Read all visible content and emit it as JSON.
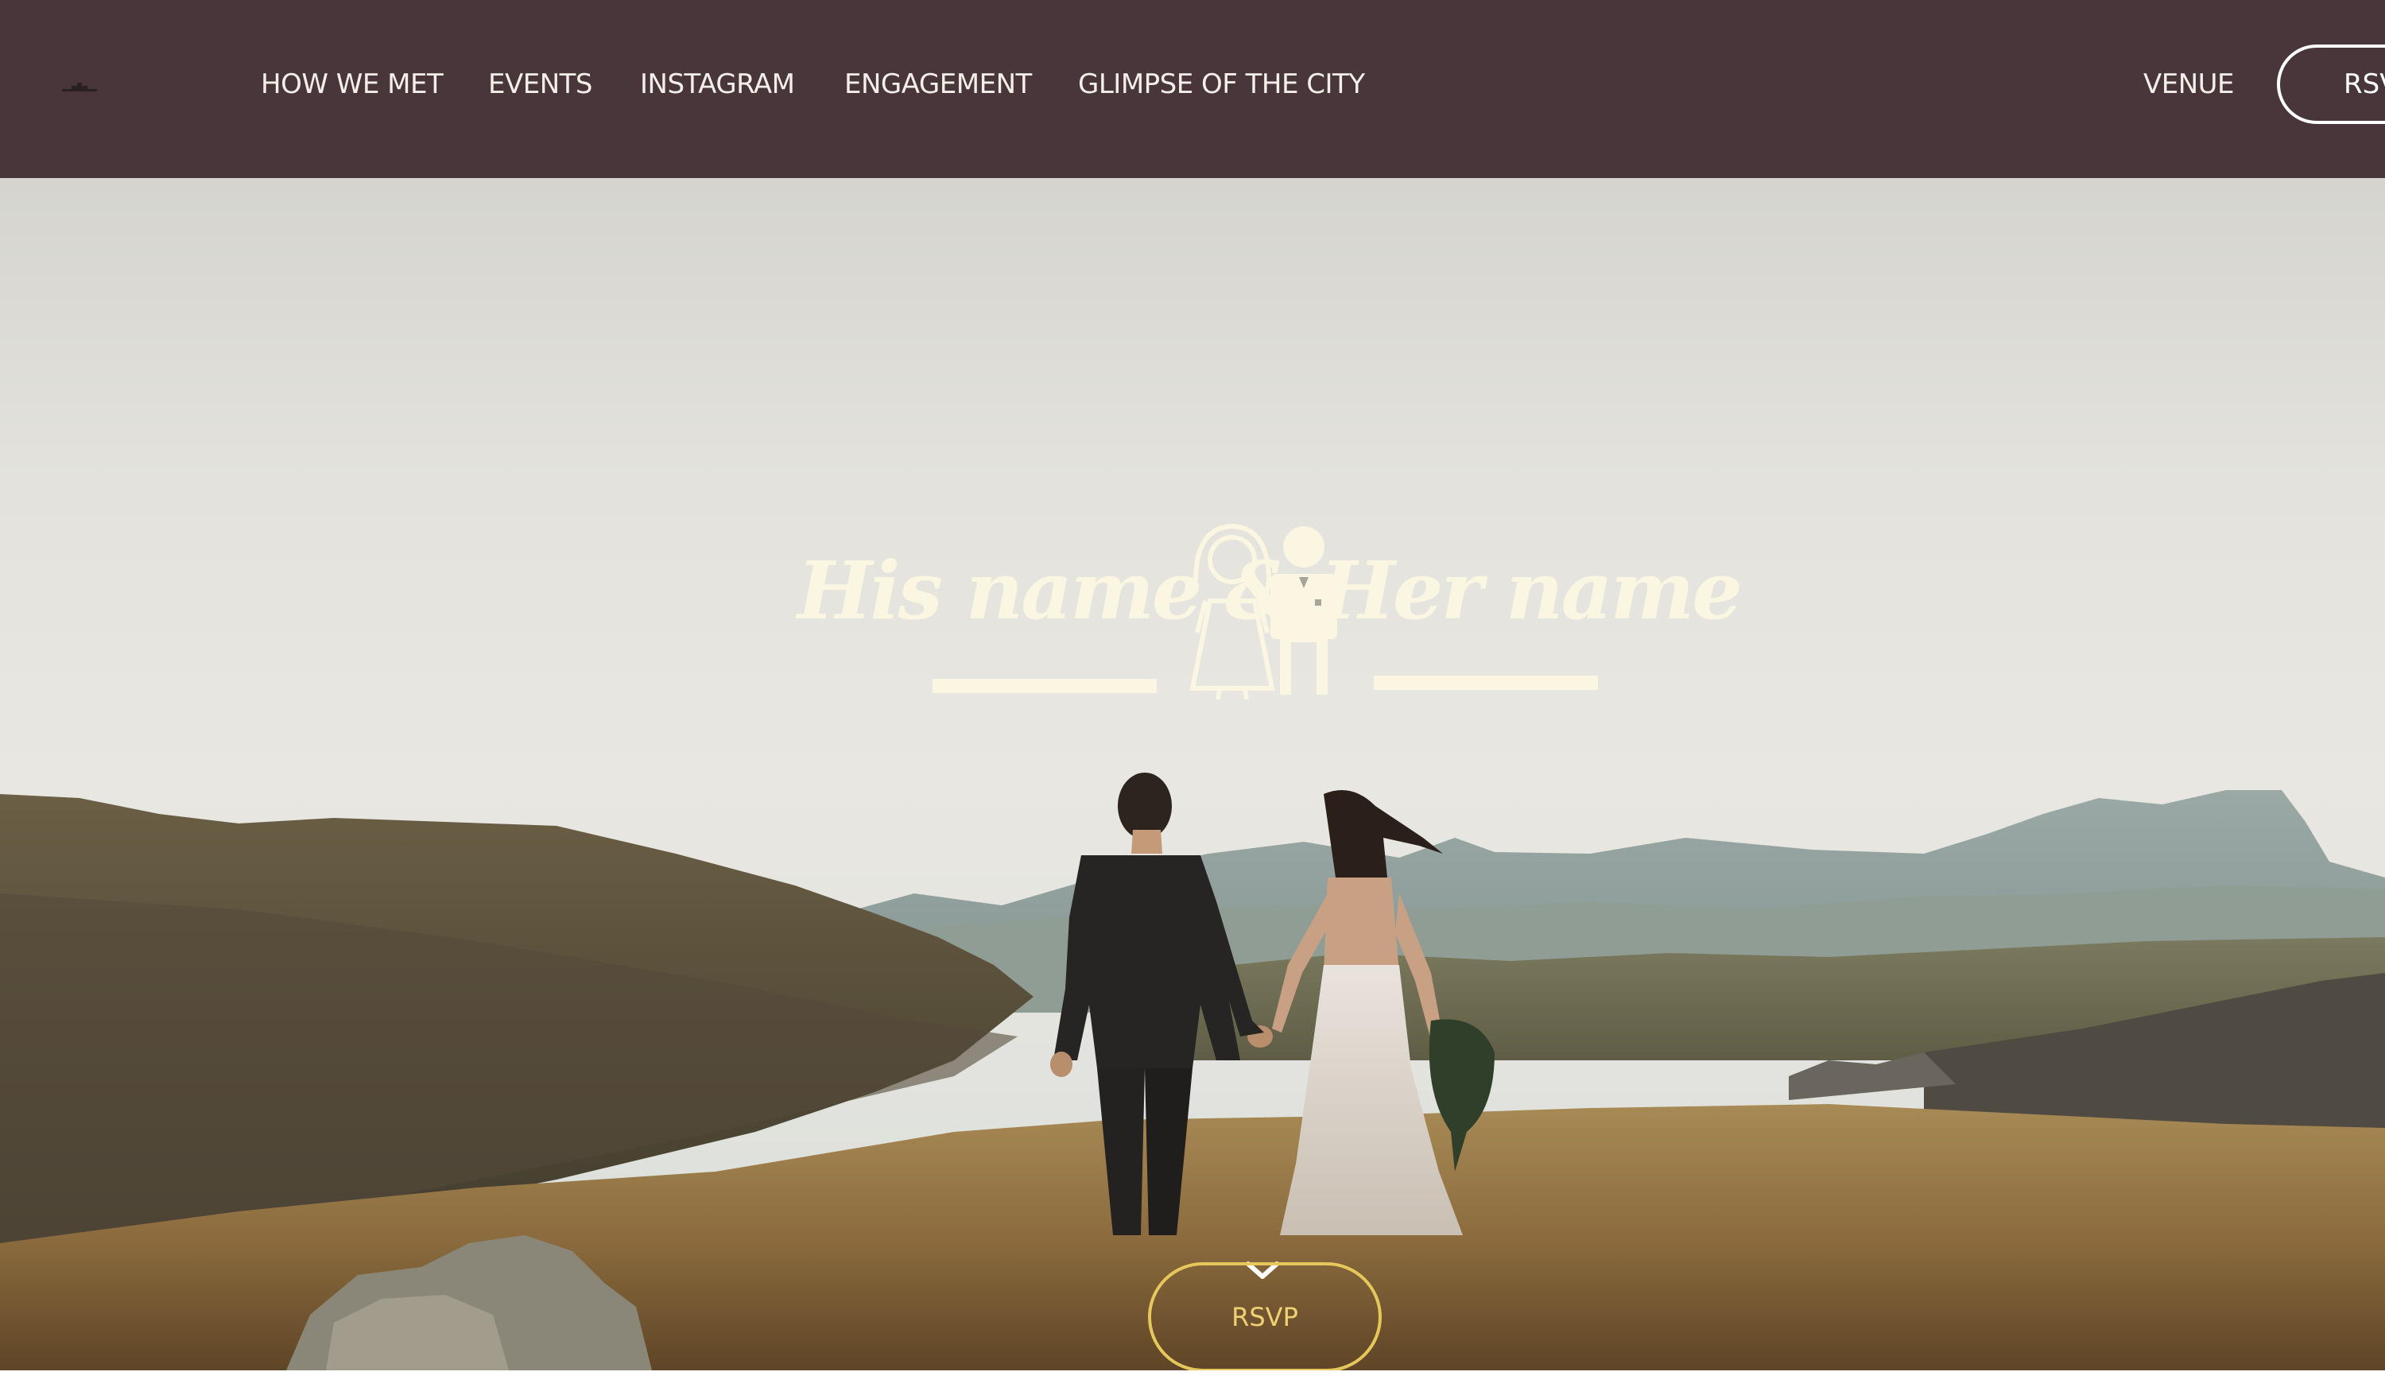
{
  "nav": {
    "links": [
      "HOW WE MET",
      "EVENTS",
      "INSTAGRAM",
      "ENGAGEMENT",
      "GLIMPSE OF THE CITY"
    ],
    "venue": "VENUE",
    "rsvp": "RSVP"
  },
  "hero": {
    "title": "His name & Her name",
    "rsvp": "RSVP"
  },
  "colors": {
    "navbar": "#48363b",
    "title": "#fbf6e2",
    "rsvp_accent": "#e5c75b"
  },
  "icons": [
    "logo-icon",
    "bride-icon",
    "groom-icon",
    "chevron-down-icon"
  ]
}
